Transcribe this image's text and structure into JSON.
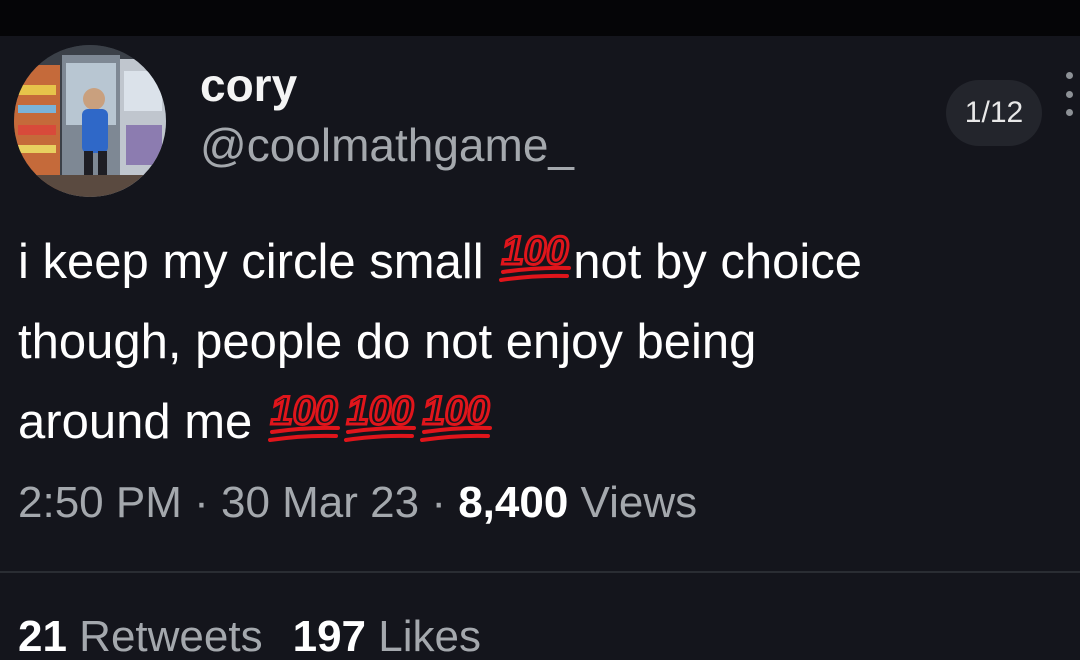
{
  "author": {
    "display_name": "cory",
    "handle": "@coolmathgame_",
    "avatar": "avatar-photo"
  },
  "thread_counter": "1/12",
  "menu_icon": "more-vertical-icon",
  "tweet": {
    "line1_before": "i keep my circle small ",
    "line1_after": "not by choice",
    "line2": "though, people do not enjoy being",
    "line3": "around me ",
    "emoji_text": "100",
    "emoji_icon": "hundred-points-emoji",
    "emoji_color": "#e0151b"
  },
  "meta": {
    "time": "2:50 PM",
    "separator": " · ",
    "date": "30 Mar 23",
    "views_count": "8,400",
    "views_label": " Views"
  },
  "stats": {
    "retweets_count": "21",
    "retweets_label": " Retweets",
    "likes_count": "197",
    "likes_label": " Likes"
  },
  "colors": {
    "background": "#14151c",
    "primary_text": "#ffffff",
    "secondary_text": "#a4a8ad"
  }
}
